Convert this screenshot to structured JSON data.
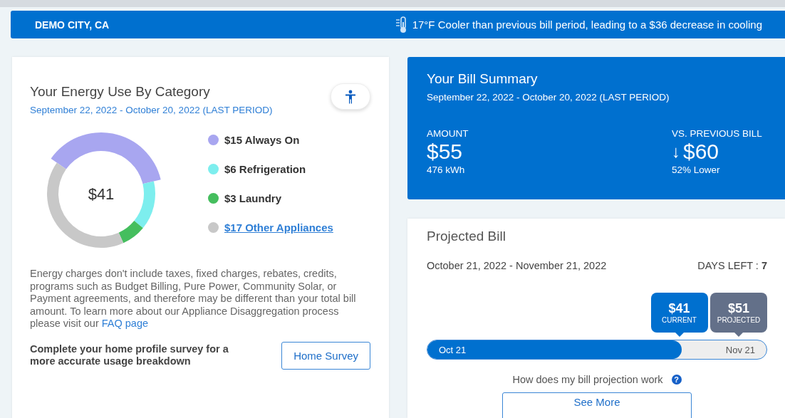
{
  "header": {
    "location": "DEMO CITY, CA",
    "weather_note": "17°F Cooler than previous bill period, leading to a $36 decrease in cooling"
  },
  "energy_use": {
    "title": "Your Energy Use By Category",
    "period": "September 22, 2022 - October 20, 2022 (LAST PERIOD)",
    "total": "$41",
    "chart_data": {
      "type": "donut",
      "categories": [
        "$15 Always On",
        "$6 Refrigeration",
        "$3 Laundry",
        "$17 Other Appliances"
      ],
      "values": [
        15,
        6,
        3,
        17
      ]
    },
    "legend": [
      {
        "color": "#a8a6f0",
        "kind": "text"
      },
      {
        "color": "#7deeee",
        "kind": "text"
      },
      {
        "color": "#45be5e",
        "kind": "text"
      },
      {
        "color": "#c8c8c8",
        "kind": "link"
      }
    ],
    "disclaimer": "Energy charges don't include taxes, fixed charges, rebates, credits, programs such as Budget Billing, Pure Power, Community Solar, or Payment agreements, and therefore may be different than your total bill amount. To learn more about our Appliance Disaggregation process please visit our ",
    "faq_link": "FAQ page",
    "survey_prompt": "Complete your home profile survey for a more accurate usage breakdown",
    "survey_button": "Home Survey"
  },
  "bill_summary": {
    "title": "Your Bill Summary",
    "period": "September 22, 2022 - October 20, 2022 (LAST PERIOD)",
    "amount_label": "AMOUNT",
    "amount": "$55",
    "usage": "476 kWh",
    "compare_label": "VS. PREVIOUS BILL",
    "compare_arrow": "↓",
    "compare_amount": "$60",
    "compare_note": "52% Lower"
  },
  "projected_bill": {
    "title": "Projected Bill",
    "period": "October 21, 2022 - November 21, 2022",
    "days_left_label": "DAYS LEFT : ",
    "days_left": "7",
    "current": {
      "amount": "$41",
      "label": "CURRENT"
    },
    "projected": {
      "amount": "$51",
      "label": "PROJECTED"
    },
    "start": "Oct 21",
    "end": "Nov 21",
    "level": 0.75,
    "help": "How does my bill projection work",
    "help_icon": "?",
    "see_more": "See More"
  }
}
